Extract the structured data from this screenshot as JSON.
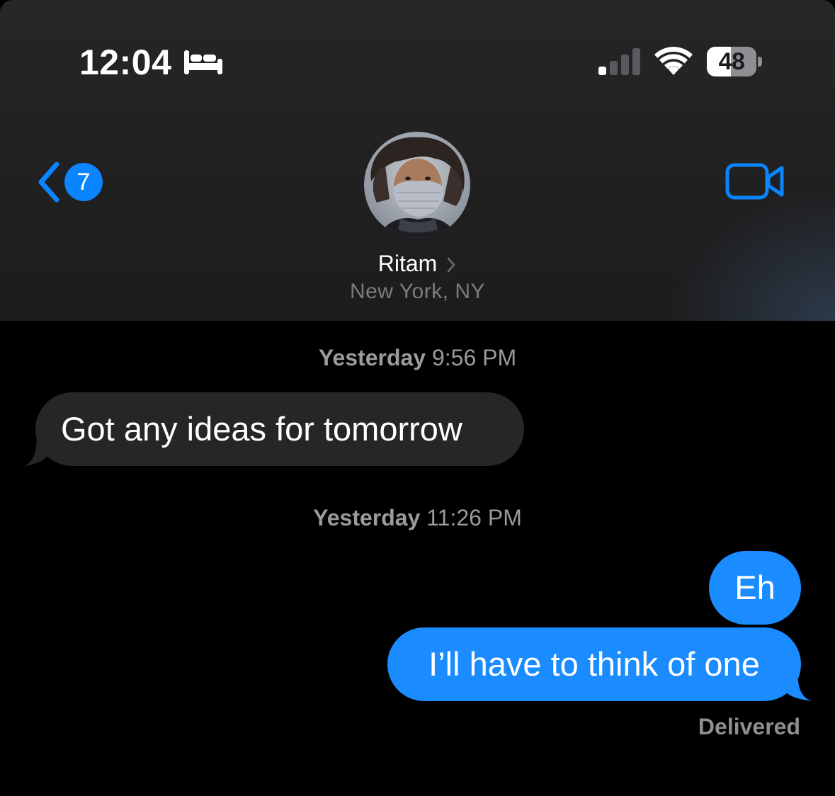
{
  "status_bar": {
    "time": "12:04",
    "focus_icon": "bed-icon",
    "signal_icon": "cellular-signal-icon",
    "signal_bars_active": 1,
    "signal_bars_total": 4,
    "wifi_icon": "wifi-icon",
    "battery_level": "48",
    "battery_fraction": 0.48
  },
  "nav": {
    "back_icon": "chevron-left-icon",
    "unread_count": "7",
    "video_icon": "video-camera-icon",
    "accent_color": "#0a84ff"
  },
  "contact": {
    "name": "Ritam",
    "location": "New York, NY",
    "avatar_icon": "contact-photo"
  },
  "conversation": {
    "groups": [
      {
        "timestamp_day": "Yesterday",
        "timestamp_time": "9:56 PM",
        "messages": [
          {
            "direction": "incoming",
            "text": "Got any ideas for tomorrow"
          }
        ]
      },
      {
        "timestamp_day": "Yesterday",
        "timestamp_time": "11:26 PM",
        "messages": [
          {
            "direction": "outgoing",
            "text": "Eh"
          },
          {
            "direction": "outgoing",
            "text": "I’ll have to think of one"
          }
        ]
      }
    ],
    "delivery_status": "Delivered"
  },
  "colors": {
    "incoming_bubble": "#262628",
    "outgoing_bubble": "#1a8cff",
    "background": "#000000",
    "secondary_text": "#9a9a9f"
  }
}
